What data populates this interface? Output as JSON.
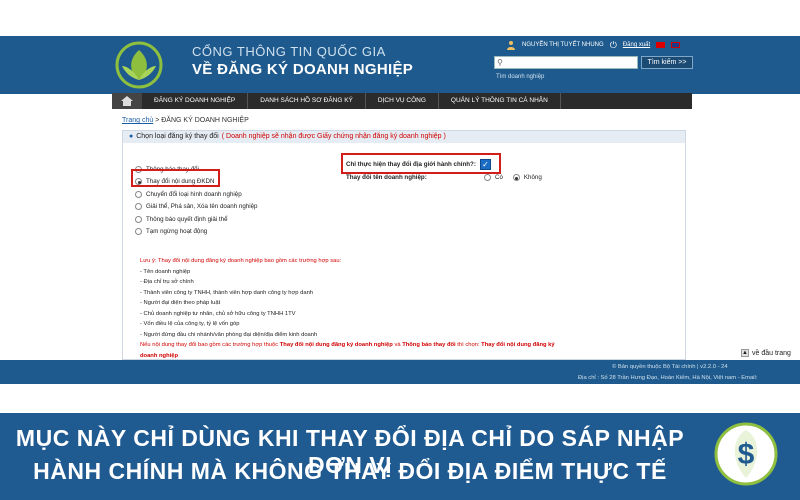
{
  "header": {
    "portal_title": "CỔNG THÔNG TIN QUỐC GIA",
    "portal_subtitle": "VỀ ĐĂNG KÝ DOANH NGHIỆP",
    "user_name": "NGUYỄN THỊ TUYẾT NHUNG",
    "logout": "Đăng xuất",
    "search_placeholder": "",
    "search_button": "Tìm kiếm >>",
    "search_link": "Tìm doanh nghiệp"
  },
  "nav": {
    "items": [
      "ĐĂNG KÝ DOANH NGHIỆP",
      "DANH SÁCH HỒ SƠ ĐĂNG KÝ",
      "DỊCH VỤ CÔNG",
      "QUẢN LÝ THÔNG TIN CÁ NHÂN"
    ]
  },
  "breadcrumb": {
    "home": "Trang chủ",
    "current": "> ĐĂNG KÝ DOANH NGHIỆP"
  },
  "section": {
    "title": "Chọn loại đăng ký thay đổi",
    "notice": "( Doanh nghiệp sẽ nhận được Giấy chứng nhận đăng ký doanh nghiệp )"
  },
  "options": [
    {
      "label": "Thông báo thay đổi",
      "selected": false
    },
    {
      "label": "Thay đổi nội dung ĐKDN",
      "selected": true
    },
    {
      "label": "Chuyển đổi loại hình doanh nghiệp",
      "selected": false
    },
    {
      "label": "Giải thể, Phá sản, Xóa tên doanh nghiệp",
      "selected": false
    },
    {
      "label": "Thông báo quyết định giải thể",
      "selected": false
    },
    {
      "label": "Tạm ngừng hoạt động",
      "selected": false
    }
  ],
  "questions": {
    "q1": "Chỉ thực hiện thay đổi địa giới hành chính?:",
    "q1_checked": true,
    "q2": "Thay đổi tên doanh nghiệp:",
    "yes": "Có",
    "no": "Không",
    "selected": "Không"
  },
  "notes": {
    "intro": "Lưu ý: Thay đổi nội dung đăng ký doanh nghiệp bao gồm các trường hợp sau:",
    "items": [
      "- Tên doanh nghiệp",
      "- Địa chỉ trụ sở chính",
      "- Thành viên công ty TNHH, thành viên hợp danh công ty hợp danh",
      "- Người đại diện theo pháp luật",
      "- Chủ doanh nghiệp tư nhân, chủ sở hữu công ty TNHH 1TV",
      "- Vốn điều lệ của công ty, tỷ lệ vốn góp",
      "- Người đứng đầu chi nhánh/văn phòng đại diện/địa điểm kinh doanh"
    ],
    "footer_a": "Nếu nội dung thay đổi bao gồm các trường hợp thuộc",
    "footer_b": "Thay đổi nội dung đăng ký doanh nghiệp",
    "footer_c": "và",
    "footer_d": "Thông báo thay đổi",
    "footer_e": "thì chọn:",
    "footer_f": "Thay đổi nội dung đăng ký doanh nghiệp"
  },
  "footer": {
    "copyright": "© Bản quyền thuộc Bộ Tài chính | v2.2.0 - 24",
    "address": "Địa chỉ : Số 28 Trần Hưng Đạo, Hoàn Kiếm, Hà Nội, Việt nam - Email:",
    "scroll_top": "về đầu trang"
  },
  "banner": {
    "line1": "MỤC NÀY CHỈ DÙNG KHI THAY ĐỔI ĐỊA CHỈ DO SÁP NHẬP ĐƠN VỊ",
    "line2": "HÀNH CHÍNH MÀ KHÔNG THAY ĐỔI ĐỊA ĐIỂM THỰC TẾ"
  },
  "colors": {
    "header_blue": "#1e5a8d",
    "highlight_red": "#d21d1d",
    "notice_red": "#d10000",
    "nav_dark": "#2b2b2b"
  }
}
